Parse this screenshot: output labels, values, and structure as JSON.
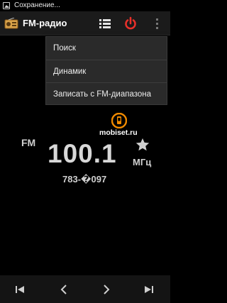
{
  "status_bar": {
    "text": "Сохранение...",
    "icon": "image-icon"
  },
  "action_bar": {
    "title": "FM-радио",
    "app_icon": "radio-icon",
    "actions": [
      "list-icon",
      "power-icon",
      "overflow-icon"
    ],
    "power_color": "#e8302a"
  },
  "menu": {
    "items": [
      {
        "label": "Поиск"
      },
      {
        "label": "Динамик"
      },
      {
        "label": "Записать с FM-диапазона"
      }
    ]
  },
  "tuner": {
    "band": "FM",
    "frequency": "100.1",
    "unit": "МГц",
    "rds_text": "783-�097",
    "favorite_icon": "star-icon"
  },
  "watermark": {
    "text": "mobiset.ru",
    "accent": "#f08a00"
  },
  "controls": {
    "icons": [
      "skip-previous-icon",
      "previous-icon",
      "next-icon",
      "skip-next-icon"
    ]
  }
}
